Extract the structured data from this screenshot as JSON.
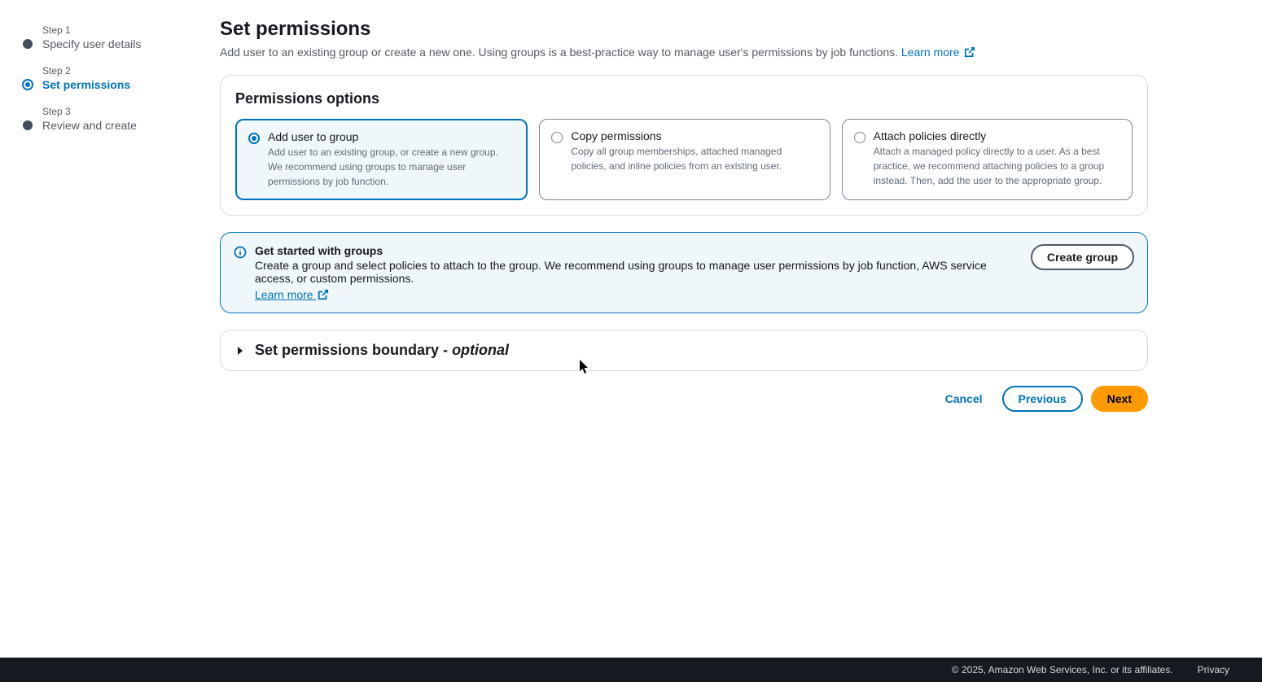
{
  "sidebar": {
    "steps": [
      {
        "label": "Step 1",
        "title": "Specify user details"
      },
      {
        "label": "Step 2",
        "title": "Set permissions"
      },
      {
        "label": "Step 3",
        "title": "Review and create"
      }
    ]
  },
  "header": {
    "title": "Set permissions",
    "description": "Add user to an existing group or create a new one. Using groups is a best-practice way to manage user's permissions by job functions. ",
    "learnMore": "Learn more"
  },
  "permissionsPanel": {
    "title": "Permissions options",
    "options": [
      {
        "title": "Add user to group",
        "desc": "Add user to an existing group, or create a new group. We recommend using groups to manage user permissions by job function."
      },
      {
        "title": "Copy permissions",
        "desc": "Copy all group memberships, attached managed policies, and inline policies from an existing user."
      },
      {
        "title": "Attach policies directly",
        "desc": "Attach a managed policy directly to a user. As a best practice, we recommend attaching policies to a group instead. Then, add the user to the appropriate group."
      }
    ]
  },
  "infoBox": {
    "title": "Get started with groups",
    "desc": "Create a group and select policies to attach to the group. We recommend using groups to manage user permissions by job function, AWS service access, or custom permissions.",
    "learnMore": "Learn more",
    "button": "Create group"
  },
  "boundary": {
    "title": "Set permissions boundary - ",
    "optional": "optional"
  },
  "actions": {
    "cancel": "Cancel",
    "previous": "Previous",
    "next": "Next"
  },
  "footer": {
    "copyright": "© 2025, Amazon Web Services, Inc. or its affiliates.",
    "privacy": "Privacy"
  }
}
